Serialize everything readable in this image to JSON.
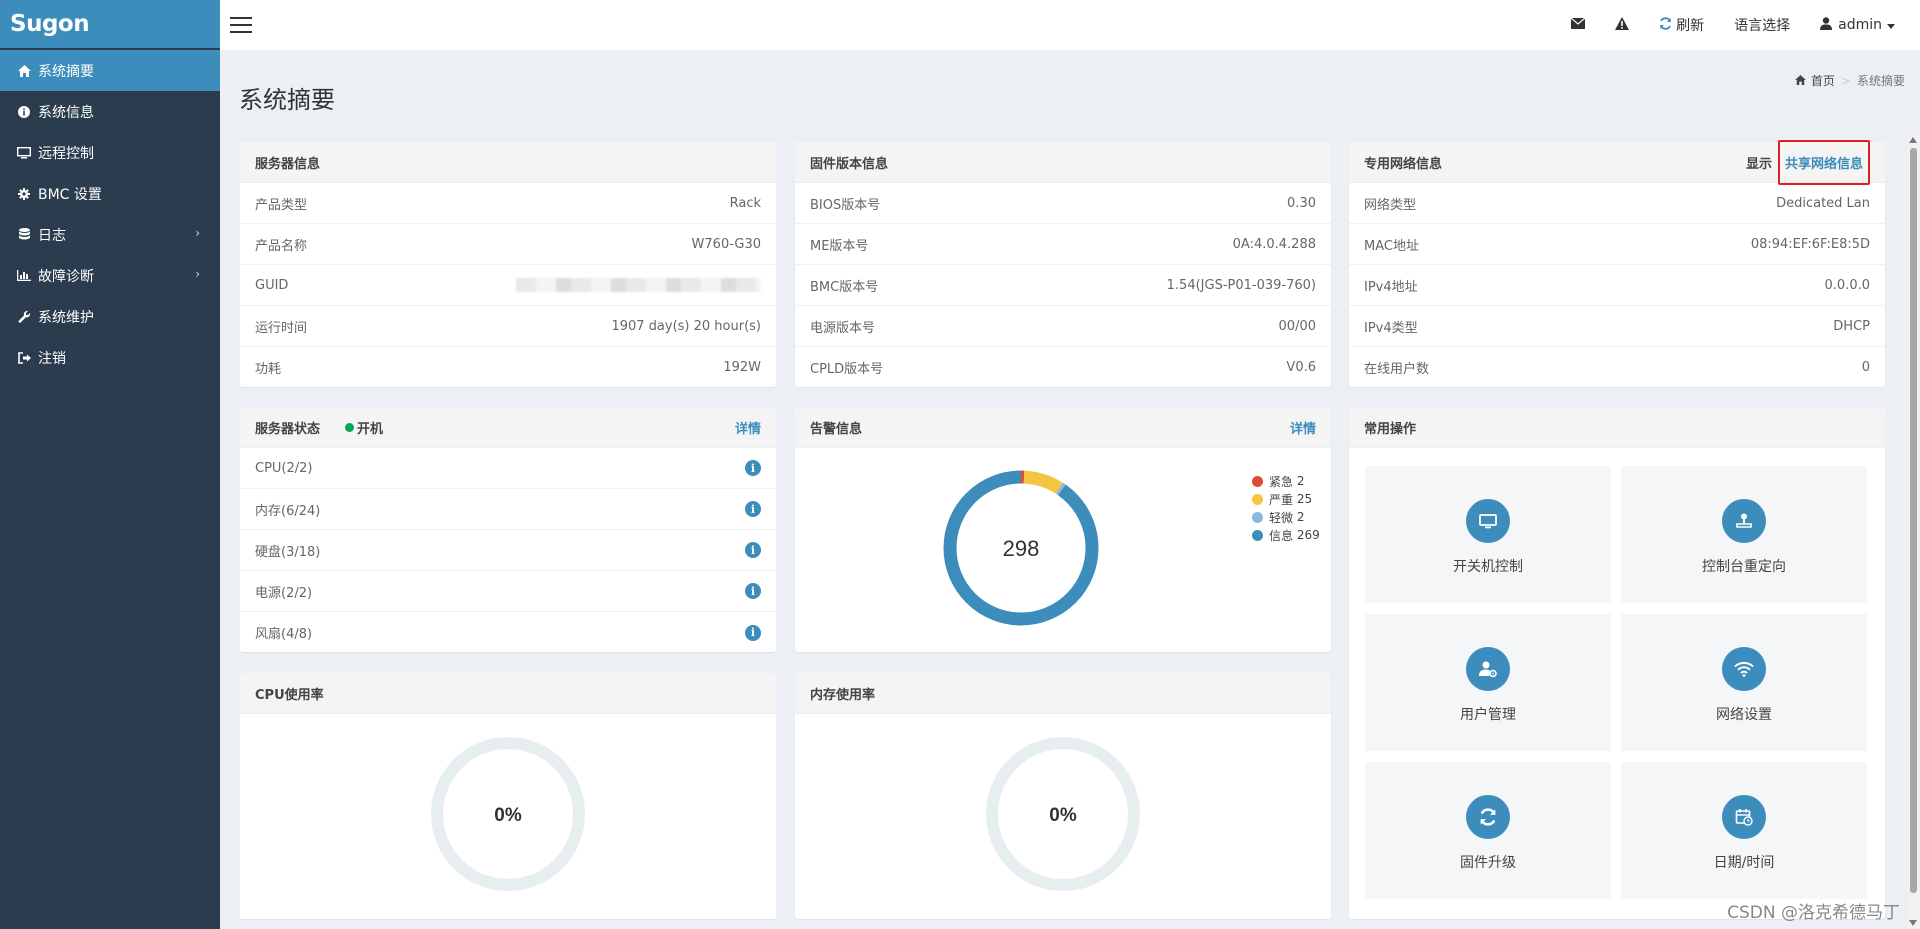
{
  "app": {
    "logo": "Sugon"
  },
  "sidebar": {
    "items": [
      {
        "label": "系统摘要",
        "icon": "home-icon",
        "active": true
      },
      {
        "label": "系统信息",
        "icon": "info-circle-icon"
      },
      {
        "label": "远程控制",
        "icon": "monitor-icon"
      },
      {
        "label": "BMC 设置",
        "icon": "gear-icon"
      },
      {
        "label": "日志",
        "icon": "database-icon",
        "has_submenu": true
      },
      {
        "label": "故障诊断",
        "icon": "bar-chart-icon",
        "has_submenu": true
      },
      {
        "label": "系统维护",
        "icon": "wrench-icon"
      },
      {
        "label": "注销",
        "icon": "sign-out-icon"
      }
    ]
  },
  "topbar": {
    "refresh_label": "刷新",
    "language_label": "语言选择",
    "user_label": "admin"
  },
  "page": {
    "title": "系统摘要",
    "breadcrumb_home": "首页",
    "breadcrumb_current": "系统摘要"
  },
  "server_info": {
    "title": "服务器信息",
    "rows": [
      {
        "label": "产品类型",
        "value": "Rack"
      },
      {
        "label": "产品名称",
        "value": "W760-G30"
      },
      {
        "label": "GUID",
        "value": ""
      },
      {
        "label": "运行时间",
        "value": "1907 day(s) 20 hour(s)"
      },
      {
        "label": "功耗",
        "value": "192W"
      }
    ]
  },
  "firmware_info": {
    "title": "固件版本信息",
    "rows": [
      {
        "label": "BIOS版本号",
        "value": "0.30"
      },
      {
        "label": "ME版本号",
        "value": "0A:4.0.4.288"
      },
      {
        "label": "BMC版本号",
        "value": "1.54(JGS-P01-039-760)"
      },
      {
        "label": "电源版本号",
        "value": "00/00"
      },
      {
        "label": "CPLD版本号",
        "value": "V0.6"
      }
    ]
  },
  "network_info": {
    "title": "专用网络信息",
    "show_label": "显示",
    "shared_link": "共享网络信息",
    "rows": [
      {
        "label": "网络类型",
        "value": "Dedicated Lan"
      },
      {
        "label": "MAC地址",
        "value": "08:94:EF:6F:E8:5D"
      },
      {
        "label": "IPv4地址",
        "value": "0.0.0.0"
      },
      {
        "label": "IPv4类型",
        "value": "DHCP"
      },
      {
        "label": "在线用户数",
        "value": "0"
      }
    ]
  },
  "server_status": {
    "title": "服务器状态",
    "power_state": "开机",
    "power_color": "#00a65a",
    "details_label": "详情",
    "rows": [
      {
        "label": "CPU(2/2)"
      },
      {
        "label": "内存(6/24)"
      },
      {
        "label": "硬盘(3/18)"
      },
      {
        "label": "电源(2/2)"
      },
      {
        "label": "风扇(4/8)"
      }
    ]
  },
  "alerts": {
    "title": "告警信息",
    "details_label": "详情",
    "total": "298",
    "items": [
      {
        "label": "紧急",
        "count": 2,
        "color": "#dd4b39"
      },
      {
        "label": "严重",
        "count": 25,
        "color": "#f5c542"
      },
      {
        "label": "轻微",
        "count": 2,
        "color": "#8ab8dc"
      },
      {
        "label": "信息",
        "count": 269,
        "color": "#3c8dbc"
      }
    ]
  },
  "cpu_usage": {
    "title": "CPU使用率",
    "value": "0%",
    "fraction": 0
  },
  "mem_usage": {
    "title": "内存使用率",
    "value": "0%",
    "fraction": 0
  },
  "operations": {
    "title": "常用操作",
    "items": [
      {
        "label": "开关机控制",
        "icon": "monitor-icon"
      },
      {
        "label": "控制台重定向",
        "icon": "joystick-icon"
      },
      {
        "label": "用户管理",
        "icon": "user-settings-icon"
      },
      {
        "label": "网络设置",
        "icon": "wifi-icon"
      },
      {
        "label": "固件升级",
        "icon": "refresh-icon"
      },
      {
        "label": "日期/时间",
        "icon": "calendar-clock-icon"
      }
    ]
  },
  "watermark": "CSDN @洛克希德马丁"
}
